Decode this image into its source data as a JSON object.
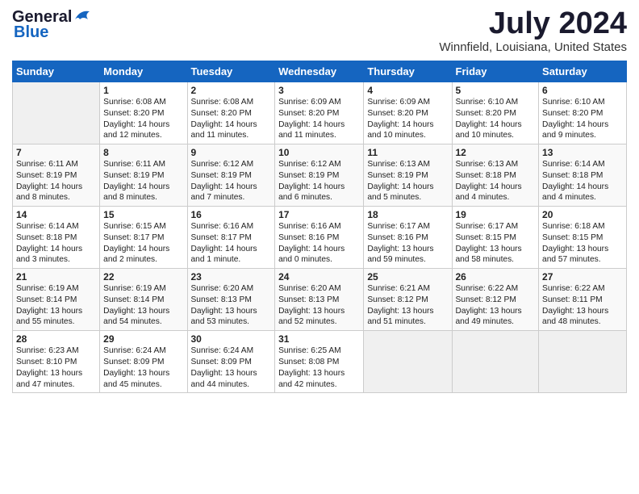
{
  "header": {
    "logo_general": "General",
    "logo_blue": "Blue",
    "title": "July 2024",
    "location": "Winnfield, Louisiana, United States"
  },
  "weekdays": [
    "Sunday",
    "Monday",
    "Tuesday",
    "Wednesday",
    "Thursday",
    "Friday",
    "Saturday"
  ],
  "weeks": [
    [
      {
        "num": "",
        "sunrise": "",
        "sunset": "",
        "daylight": ""
      },
      {
        "num": "1",
        "sunrise": "Sunrise: 6:08 AM",
        "sunset": "Sunset: 8:20 PM",
        "daylight": "Daylight: 14 hours and 12 minutes."
      },
      {
        "num": "2",
        "sunrise": "Sunrise: 6:08 AM",
        "sunset": "Sunset: 8:20 PM",
        "daylight": "Daylight: 14 hours and 11 minutes."
      },
      {
        "num": "3",
        "sunrise": "Sunrise: 6:09 AM",
        "sunset": "Sunset: 8:20 PM",
        "daylight": "Daylight: 14 hours and 11 minutes."
      },
      {
        "num": "4",
        "sunrise": "Sunrise: 6:09 AM",
        "sunset": "Sunset: 8:20 PM",
        "daylight": "Daylight: 14 hours and 10 minutes."
      },
      {
        "num": "5",
        "sunrise": "Sunrise: 6:10 AM",
        "sunset": "Sunset: 8:20 PM",
        "daylight": "Daylight: 14 hours and 10 minutes."
      },
      {
        "num": "6",
        "sunrise": "Sunrise: 6:10 AM",
        "sunset": "Sunset: 8:20 PM",
        "daylight": "Daylight: 14 hours and 9 minutes."
      }
    ],
    [
      {
        "num": "7",
        "sunrise": "Sunrise: 6:11 AM",
        "sunset": "Sunset: 8:19 PM",
        "daylight": "Daylight: 14 hours and 8 minutes."
      },
      {
        "num": "8",
        "sunrise": "Sunrise: 6:11 AM",
        "sunset": "Sunset: 8:19 PM",
        "daylight": "Daylight: 14 hours and 8 minutes."
      },
      {
        "num": "9",
        "sunrise": "Sunrise: 6:12 AM",
        "sunset": "Sunset: 8:19 PM",
        "daylight": "Daylight: 14 hours and 7 minutes."
      },
      {
        "num": "10",
        "sunrise": "Sunrise: 6:12 AM",
        "sunset": "Sunset: 8:19 PM",
        "daylight": "Daylight: 14 hours and 6 minutes."
      },
      {
        "num": "11",
        "sunrise": "Sunrise: 6:13 AM",
        "sunset": "Sunset: 8:19 PM",
        "daylight": "Daylight: 14 hours and 5 minutes."
      },
      {
        "num": "12",
        "sunrise": "Sunrise: 6:13 AM",
        "sunset": "Sunset: 8:18 PM",
        "daylight": "Daylight: 14 hours and 4 minutes."
      },
      {
        "num": "13",
        "sunrise": "Sunrise: 6:14 AM",
        "sunset": "Sunset: 8:18 PM",
        "daylight": "Daylight: 14 hours and 4 minutes."
      }
    ],
    [
      {
        "num": "14",
        "sunrise": "Sunrise: 6:14 AM",
        "sunset": "Sunset: 8:18 PM",
        "daylight": "Daylight: 14 hours and 3 minutes."
      },
      {
        "num": "15",
        "sunrise": "Sunrise: 6:15 AM",
        "sunset": "Sunset: 8:17 PM",
        "daylight": "Daylight: 14 hours and 2 minutes."
      },
      {
        "num": "16",
        "sunrise": "Sunrise: 6:16 AM",
        "sunset": "Sunset: 8:17 PM",
        "daylight": "Daylight: 14 hours and 1 minute."
      },
      {
        "num": "17",
        "sunrise": "Sunrise: 6:16 AM",
        "sunset": "Sunset: 8:16 PM",
        "daylight": "Daylight: 14 hours and 0 minutes."
      },
      {
        "num": "18",
        "sunrise": "Sunrise: 6:17 AM",
        "sunset": "Sunset: 8:16 PM",
        "daylight": "Daylight: 13 hours and 59 minutes."
      },
      {
        "num": "19",
        "sunrise": "Sunrise: 6:17 AM",
        "sunset": "Sunset: 8:15 PM",
        "daylight": "Daylight: 13 hours and 58 minutes."
      },
      {
        "num": "20",
        "sunrise": "Sunrise: 6:18 AM",
        "sunset": "Sunset: 8:15 PM",
        "daylight": "Daylight: 13 hours and 57 minutes."
      }
    ],
    [
      {
        "num": "21",
        "sunrise": "Sunrise: 6:19 AM",
        "sunset": "Sunset: 8:14 PM",
        "daylight": "Daylight: 13 hours and 55 minutes."
      },
      {
        "num": "22",
        "sunrise": "Sunrise: 6:19 AM",
        "sunset": "Sunset: 8:14 PM",
        "daylight": "Daylight: 13 hours and 54 minutes."
      },
      {
        "num": "23",
        "sunrise": "Sunrise: 6:20 AM",
        "sunset": "Sunset: 8:13 PM",
        "daylight": "Daylight: 13 hours and 53 minutes."
      },
      {
        "num": "24",
        "sunrise": "Sunrise: 6:20 AM",
        "sunset": "Sunset: 8:13 PM",
        "daylight": "Daylight: 13 hours and 52 minutes."
      },
      {
        "num": "25",
        "sunrise": "Sunrise: 6:21 AM",
        "sunset": "Sunset: 8:12 PM",
        "daylight": "Daylight: 13 hours and 51 minutes."
      },
      {
        "num": "26",
        "sunrise": "Sunrise: 6:22 AM",
        "sunset": "Sunset: 8:12 PM",
        "daylight": "Daylight: 13 hours and 49 minutes."
      },
      {
        "num": "27",
        "sunrise": "Sunrise: 6:22 AM",
        "sunset": "Sunset: 8:11 PM",
        "daylight": "Daylight: 13 hours and 48 minutes."
      }
    ],
    [
      {
        "num": "28",
        "sunrise": "Sunrise: 6:23 AM",
        "sunset": "Sunset: 8:10 PM",
        "daylight": "Daylight: 13 hours and 47 minutes."
      },
      {
        "num": "29",
        "sunrise": "Sunrise: 6:24 AM",
        "sunset": "Sunset: 8:09 PM",
        "daylight": "Daylight: 13 hours and 45 minutes."
      },
      {
        "num": "30",
        "sunrise": "Sunrise: 6:24 AM",
        "sunset": "Sunset: 8:09 PM",
        "daylight": "Daylight: 13 hours and 44 minutes."
      },
      {
        "num": "31",
        "sunrise": "Sunrise: 6:25 AM",
        "sunset": "Sunset: 8:08 PM",
        "daylight": "Daylight: 13 hours and 42 minutes."
      },
      {
        "num": "",
        "sunrise": "",
        "sunset": "",
        "daylight": ""
      },
      {
        "num": "",
        "sunrise": "",
        "sunset": "",
        "daylight": ""
      },
      {
        "num": "",
        "sunrise": "",
        "sunset": "",
        "daylight": ""
      }
    ]
  ]
}
